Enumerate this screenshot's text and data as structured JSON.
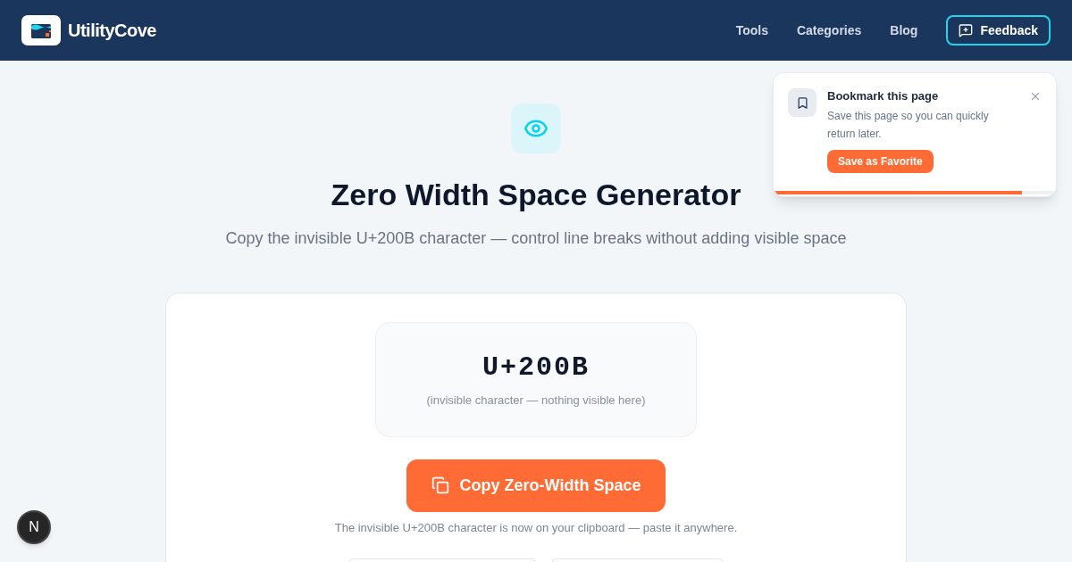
{
  "header": {
    "logo_text": "UtilityCove",
    "nav": [
      {
        "label": "Tools"
      },
      {
        "label": "Categories"
      },
      {
        "label": "Blog"
      }
    ],
    "feedback_button": "Feedback"
  },
  "hero": {
    "title": "Zero Width Space Generator",
    "subtitle": "Copy the invisible U+200B character — control line breaks without adding visible space"
  },
  "tool_card": {
    "code": "U+200B",
    "code_hint": "(invisible character — nothing visible here)",
    "copy_button": "Copy Zero-Width Space",
    "status_message": "The invisible U+200B character is now on your clipboard — paste it anywhere."
  },
  "toast": {
    "title": "Bookmark this page",
    "body": "Save this page so you can quickly return later.",
    "action_button": "Save as Favorite",
    "progress": {
      "level": 0.88
    }
  },
  "dev_indicator": {
    "label": "N"
  }
}
